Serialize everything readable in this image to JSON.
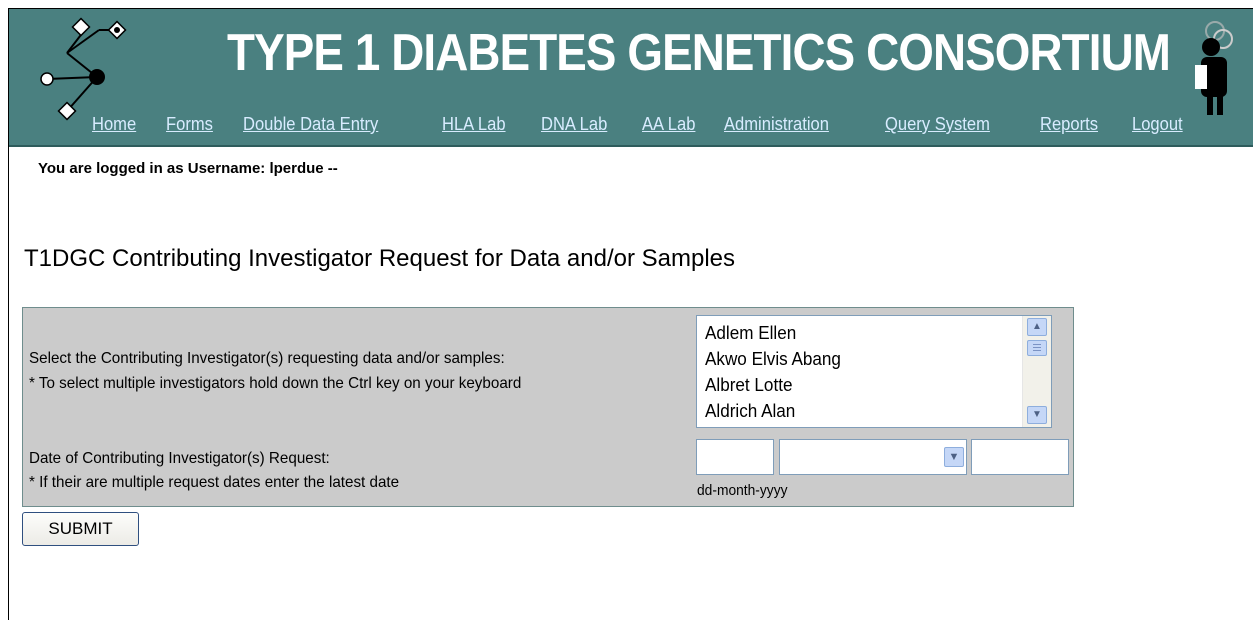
{
  "header": {
    "title": "TYPE 1 DIABETES GENETICS CONSORTIUM",
    "background_color": "#4a8080",
    "nav": [
      {
        "label": "Home"
      },
      {
        "label": "Forms"
      },
      {
        "label": "Double Data Entry"
      },
      {
        "label": "HLA Lab"
      },
      {
        "label": "DNA Lab"
      },
      {
        "label": "AA Lab"
      },
      {
        "label": "Administration"
      },
      {
        "label": "Query System"
      },
      {
        "label": "Reports"
      },
      {
        "label": "Logout"
      }
    ]
  },
  "session": {
    "logged_in_text": "You are logged in as Username:  lperdue --"
  },
  "page": {
    "title": "T1DGC Contributing Investigator Request for Data and/or Samples"
  },
  "form": {
    "investigator_label": "Select the Contributing Investigator(s) requesting data and/or samples:",
    "investigator_hint": "* To select multiple investigators hold down the Ctrl key on your keyboard",
    "investigators": [
      "Adlem Ellen",
      "Akwo Elvis Abang",
      "Albret Lotte",
      "Aldrich Alan"
    ],
    "date_label": "Date of Contributing Investigator(s) Request:",
    "date_hint": "* If their are multiple request dates enter the latest date",
    "date_format": "dd-month-yyyy",
    "day_value": "",
    "month_value": "",
    "year_value": "",
    "submit_label": "SUBMIT"
  }
}
